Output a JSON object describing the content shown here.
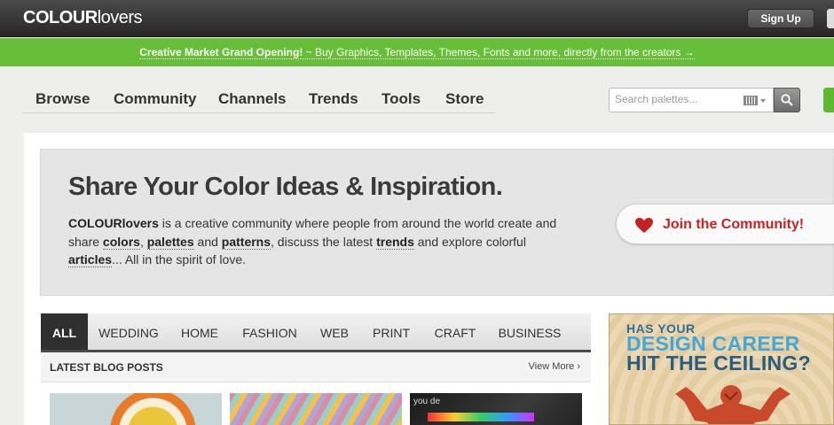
{
  "header": {
    "logo_bold": "COLOUR",
    "logo_light": "lovers",
    "signup_label": "Sign Up"
  },
  "banner": {
    "highlight": "Creative Market Grand Opening!",
    "text": " ~ Buy Graphics, Templates, Themes, Fonts and more, directly from the creators →"
  },
  "nav": {
    "items": [
      "Browse",
      "Community",
      "Channels",
      "Trends",
      "Tools",
      "Store"
    ]
  },
  "search": {
    "placeholder": "Search palettes..."
  },
  "hero": {
    "title": "Share Your Color Ideas & Inspiration.",
    "p_brand": "COLOURlovers",
    "p_t1": " is a creative community where people from around the world create and share ",
    "l_colors": "colors",
    "p_t2": ", ",
    "l_palettes": "palettes",
    "p_t3": " and ",
    "l_patterns": "patterns",
    "p_t4": ", discuss the latest ",
    "l_trends": "trends",
    "p_t5": " and explore colorful ",
    "l_articles": "articles",
    "p_t6": "... All in the spirit of love.",
    "join_label": "Join the Community!"
  },
  "tabs": [
    "ALL",
    "WEDDING",
    "HOME",
    "FASHION",
    "WEB",
    "PRINT",
    "CRAFT",
    "BUSINESS"
  ],
  "posts": {
    "title": "LATEST BLOG POSTS",
    "view_more": "View More ›",
    "thumb3_text": "you de"
  },
  "ad": {
    "line1": "HAS YOUR",
    "line2": "DESIGN CAREER",
    "line3": "HIT THE CEILING?"
  },
  "colors": {
    "accent_green": "#66bf36",
    "heart_red": "#cc2222",
    "ad_blue": "#45a7d6"
  }
}
